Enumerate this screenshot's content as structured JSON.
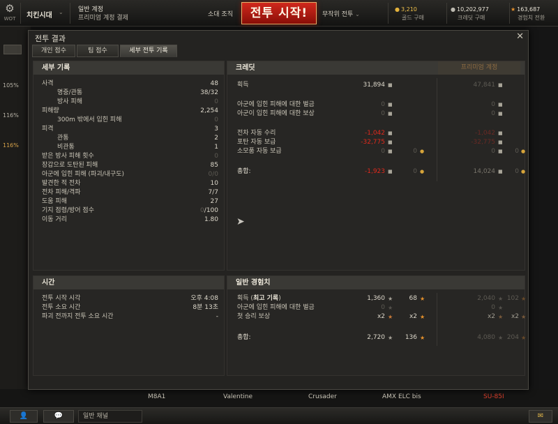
{
  "topbar": {
    "logo_label": "WOT",
    "clan": "치킨시대",
    "account_type": "일반 계정",
    "premium_link": "프리미엄 계정 결제",
    "squad": "소대 조직",
    "battle_button": "전투 시작!",
    "battle_mode": "무작위 전투",
    "gold_value": "3,210",
    "gold_label": "골드 구매",
    "credits_value": "10,202,977",
    "credits_label": "크레딧 구매",
    "xp_value": "163,687",
    "xp_label": "경험치 전환"
  },
  "background": {
    "tags": [
      "105%",
      "116%",
      "116%"
    ],
    "tanks": [
      "M8A1",
      "Valentine",
      "Crusader",
      "AMX ELC bis",
      "SU-85I"
    ]
  },
  "footer": {
    "channel": "일반 채널"
  },
  "dialog": {
    "title": "전투 결과",
    "tabs": [
      "개인 점수",
      "팀 점수",
      "세부 전투 기록"
    ],
    "details": {
      "header": "세부 기록",
      "rows": [
        {
          "label": "사격",
          "value": "48"
        },
        {
          "label": "명중/관통",
          "value": "38/32"
        },
        {
          "label": "방사 피해",
          "value": "0"
        },
        {
          "label": "피해량",
          "value": "2,254"
        },
        {
          "label": "300m 밖에서 입힌 피해",
          "value": "0"
        },
        {
          "label": "피격",
          "value": "3"
        },
        {
          "label": "관통",
          "value": "2"
        },
        {
          "label": "비관통",
          "value": "1"
        },
        {
          "label": "받은 방사 피해 횟수",
          "value": "0"
        },
        {
          "label": "장갑으로 도탄된 피해",
          "value": "85"
        },
        {
          "label": "아군에 입힌 피해 (파괴/내구도)",
          "value": "0/0"
        },
        {
          "label": "발견한 적 전차",
          "value": "10"
        },
        {
          "label": "전차 피해/격파",
          "value": "7/7"
        },
        {
          "label": "도움 피해",
          "value": "27"
        },
        {
          "label": "기지 점령/방어 점수",
          "value_a": "0",
          "value_b": "/100"
        },
        {
          "label": "이동 거리",
          "value": "1.80"
        }
      ]
    },
    "credits": {
      "header": "크레딧",
      "premium_header": "프리미엄 계정",
      "earned_label": "획득",
      "earned": "31,894",
      "earned_premium": "47,841",
      "fine_label": "아군에 입힌 피해에 대한 벌금",
      "compensation_label": "아군이 입힌 피해에 대한 보상",
      "zero": "0",
      "repair_label": "전차 자동 수리",
      "repair": "-1,042",
      "repair_premium": "-1,042",
      "ammo_label": "포탄 자동 보급",
      "ammo": "-32,775",
      "ammo_premium": "-32,775",
      "consumables_label": "소모품 자동 보급",
      "total_label": "총합:",
      "total": "-1,923",
      "total_premium": "14,024"
    },
    "time": {
      "header": "시간",
      "start_label": "전투 시작 시각",
      "start": "오후 4:08",
      "duration_label": "전투 소요 시간",
      "duration": "8분 13초",
      "destroyed_label": "파괴 전까지 전투 소요 시간",
      "destroyed": "-"
    },
    "xp": {
      "header": "일반 경험치",
      "earned_label": "획득",
      "earned_label_bold": "최고 기록",
      "earned": "1,360",
      "earned_free": "68",
      "earned_premium": "2,040",
      "earned_premium_free": "102",
      "fine_label": "아군에 입힌 피해에 대한 벌금",
      "zero": "0",
      "first_win_label": "첫 승리 보상",
      "multiplier": "x2",
      "total_label": "총합:",
      "total": "2,720",
      "total_free": "136",
      "total_premium": "4,080",
      "total_premium_free": "204"
    }
  },
  "colors": {
    "battle_button": "#c21f14",
    "negative": "#e0291c",
    "free_xp_star": "#e6912b"
  }
}
